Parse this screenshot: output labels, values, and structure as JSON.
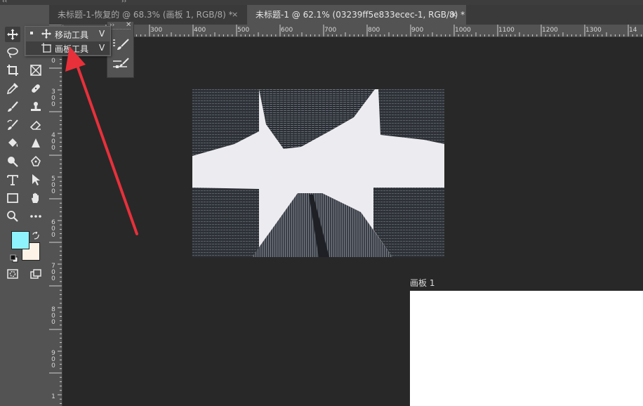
{
  "tabs": [
    {
      "title": "未标题-1-恢复的 @ 68.3% (画板 1, RGB/8) *",
      "close": "×"
    },
    {
      "title": "未标题-1 @ 62.1% (03239ff5e833ecec-1, RGB/8) *",
      "close": "×"
    }
  ],
  "ruler_h": [
    "300",
    "400",
    "500",
    "600",
    "700",
    "800",
    "900",
    "1000",
    "1100",
    "1200",
    "1300",
    "14"
  ],
  "ruler_v": [
    "200",
    "300",
    "400",
    "500",
    "600",
    "700",
    "800",
    "900",
    "1"
  ],
  "flyout": {
    "items": [
      {
        "label": "移动工具",
        "shortcut": "V",
        "icon": "move-icon"
      },
      {
        "label": "画板工具",
        "shortcut": "V",
        "icon": "artboard-icon"
      }
    ]
  },
  "artboard": {
    "label": "画板 1"
  },
  "colors": {
    "foreground": "#8ef3fd",
    "background": "#fdf3e7",
    "annotation_arrow": "#e8303a"
  },
  "tools": [
    "move-icon",
    "lasso-icon",
    "crop-icon",
    "frame-icon",
    "eyedropper-icon",
    "healing-brush-icon",
    "brush-icon",
    "clone-stamp-icon",
    "history-brush-icon",
    "eraser-icon",
    "paint-bucket-icon",
    "blur-icon",
    "dodge-icon",
    "pen-icon",
    "type-icon",
    "path-select-icon",
    "rectangle-icon",
    "hand-icon",
    "zoom-icon",
    "more-tools-icon"
  ]
}
